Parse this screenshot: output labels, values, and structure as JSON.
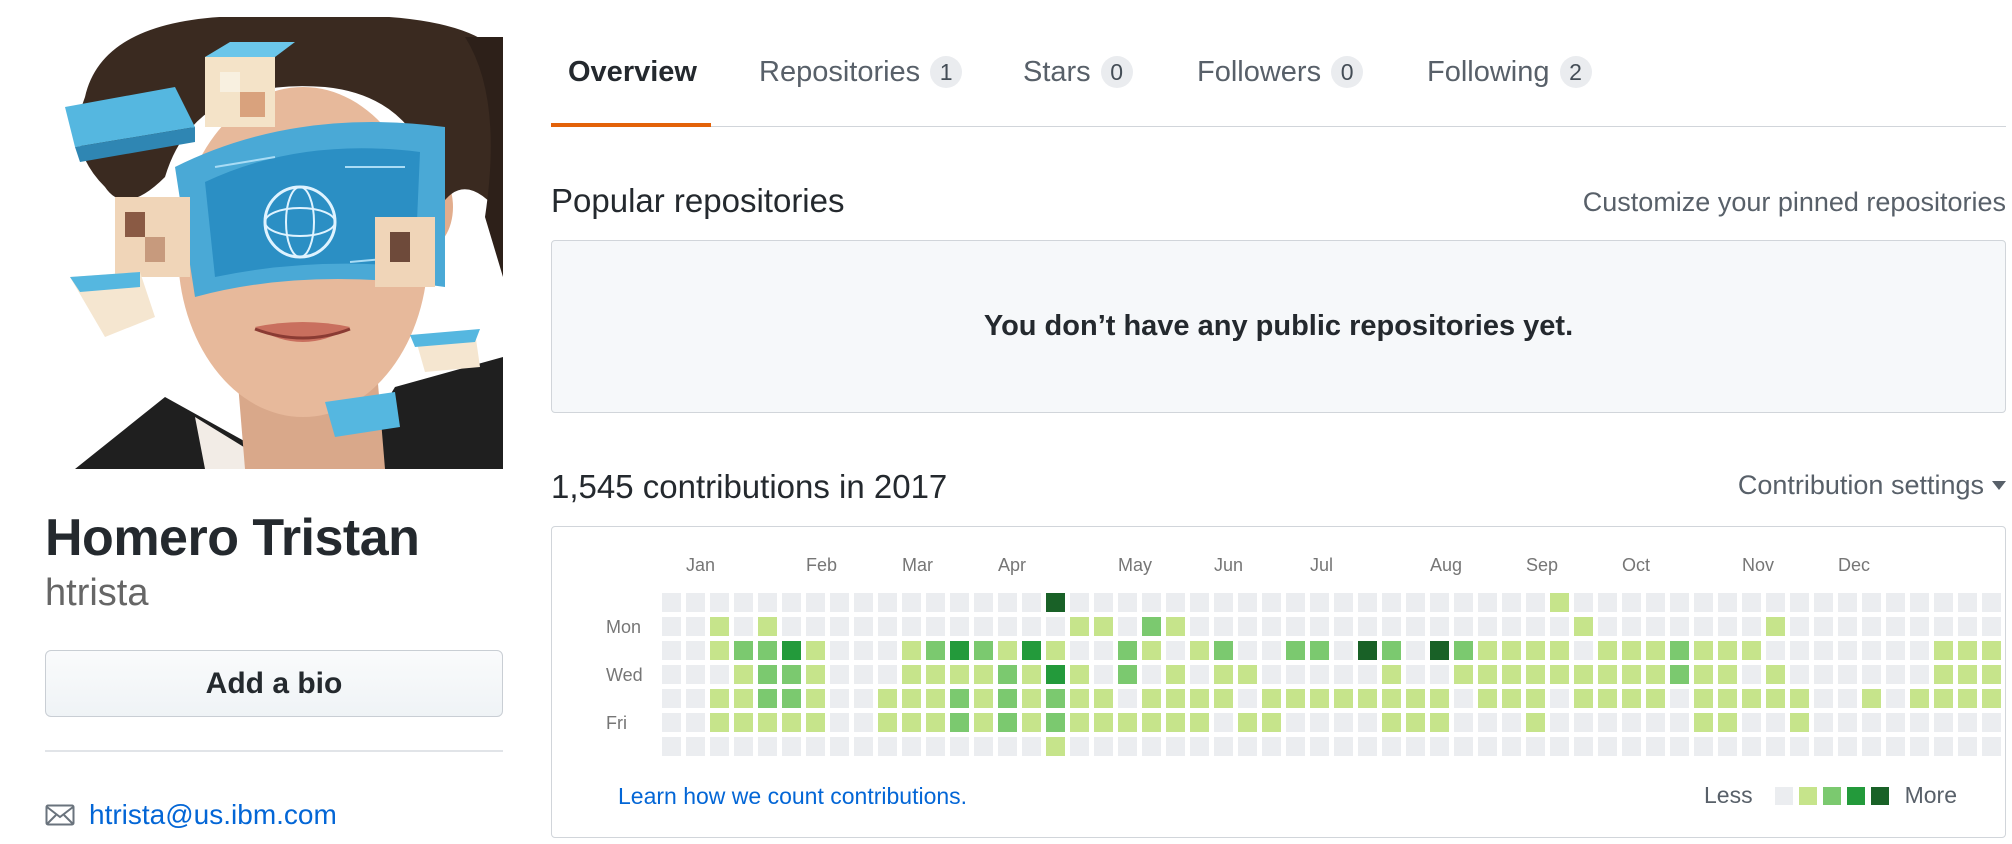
{
  "profile": {
    "name": "Homero Tristan",
    "login": "htrista",
    "add_bio_label": "Add a bio",
    "email": "htrista@us.ibm.com"
  },
  "tabs": [
    {
      "label": "Overview",
      "count": null,
      "selected": true
    },
    {
      "label": "Repositories",
      "count": "1",
      "selected": false
    },
    {
      "label": "Stars",
      "count": "0",
      "selected": false
    },
    {
      "label": "Followers",
      "count": "0",
      "selected": false
    },
    {
      "label": "Following",
      "count": "2",
      "selected": false
    }
  ],
  "popular": {
    "title": "Popular repositories",
    "customize_label": "Customize your pinned repositories",
    "empty_message": "You don’t have any public repositories yet."
  },
  "contributions": {
    "title": "1,545 contributions in 2017",
    "settings_label": "Contribution settings",
    "months": [
      "Jan",
      "Feb",
      "Mar",
      "Apr",
      "May",
      "Jun",
      "Jul",
      "Aug",
      "Sep",
      "Oct",
      "Nov",
      "Dec"
    ],
    "day_labels": [
      "Mon",
      "Wed",
      "Fri"
    ],
    "learn_label": "Learn how we count contributions.",
    "legend_less": "Less",
    "legend_more": "More",
    "level_colors": [
      "#ebedf0",
      "#c6e48b",
      "#7bc96f",
      "#239a3b",
      "#196127"
    ],
    "weeks": [
      "0000000",
      "0000000",
      "0110110",
      "0021110",
      "0122210",
      "0032210",
      "0011110",
      "0000000",
      "0000000",
      "0000110",
      "0011110",
      "0021110",
      "0031220",
      "0021110",
      "0012220",
      "0031110",
      "4013221",
      "0101110",
      "0100110",
      "0022010",
      "0210110",
      "0101110",
      "0010110",
      "0021100",
      "0001010",
      "0000110",
      "0020100",
      "0020100",
      "0000100",
      "0040100",
      "0021110",
      "0000110",
      "0040110",
      "0021000",
      "0011100",
      "0011100",
      "0011110",
      "1011000",
      "0101100",
      "0011100",
      "0011100",
      "0011100",
      "0022000",
      "0011110",
      "0011110",
      "0010100",
      "0101100",
      "0000110",
      "0000000",
      "0000000",
      "0000100",
      "0000000",
      "0000100",
      "0011100",
      "0011100",
      "0011100"
    ]
  },
  "icons": {
    "avatar": "ibm-watson-illustrated-portrait",
    "email": "mail-icon",
    "settings_caret": "triangle-down-icon"
  }
}
